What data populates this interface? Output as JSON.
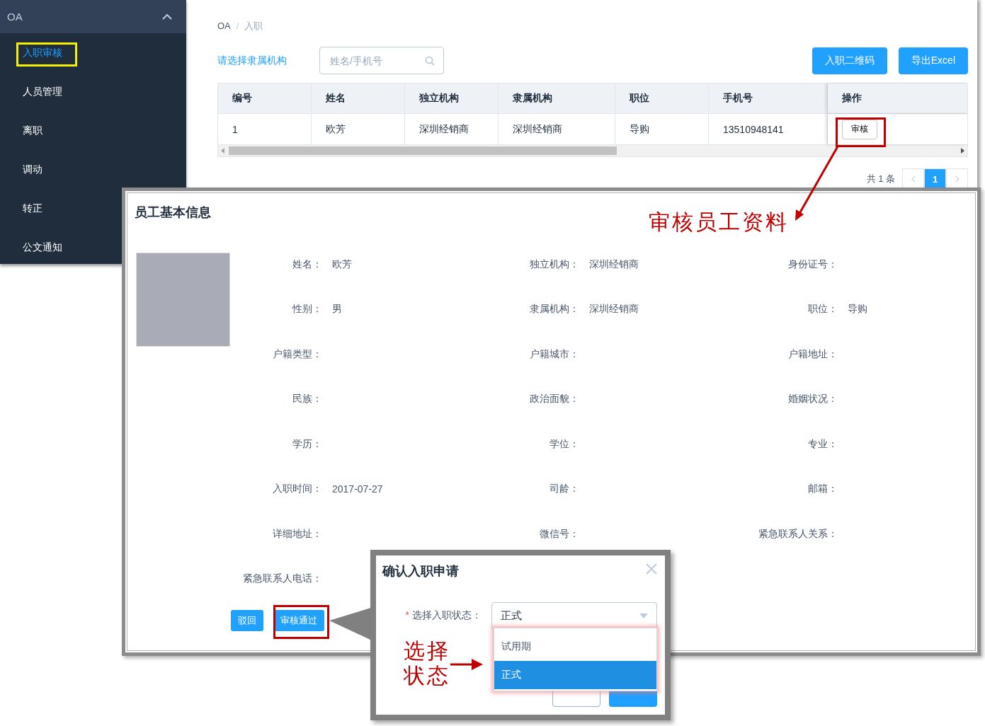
{
  "sidebar": {
    "header": "OA",
    "expanded": true,
    "items": [
      {
        "label": "入职审核",
        "selected": true
      },
      {
        "label": "人员管理",
        "selected": false
      },
      {
        "label": "离职",
        "selected": false
      },
      {
        "label": "调动",
        "selected": false
      },
      {
        "label": "转正",
        "selected": false
      },
      {
        "label": "公文通知",
        "selected": false
      }
    ]
  },
  "breadcrumb": [
    "OA",
    "入职"
  ],
  "breadcrumb_separator": "/",
  "toolbar": {
    "org_filter": "请选择隶属机构",
    "search": {
      "placeholder": "姓名/手机号"
    },
    "buttons": [
      "入职二维码",
      "导出Excel"
    ]
  },
  "table": {
    "columns": [
      "编号",
      "姓名",
      "独立机构",
      "隶属机构",
      "职位",
      "手机号",
      "操作"
    ],
    "rows": [
      {
        "cells": [
          "1",
          "欧芳",
          "深圳经销商",
          "深圳经销商",
          "导购",
          "13510948141"
        ],
        "action": "审核"
      }
    ]
  },
  "pagination": {
    "total": "共 1 条",
    "pages": [
      {
        "label": "1",
        "selected": true
      }
    ]
  },
  "detail_panel": {
    "title": "员工基本信息",
    "fields": [
      {
        "label": "姓名：",
        "value": "欧芳"
      },
      {
        "label": "独立机构：",
        "value": "深圳经销商"
      },
      {
        "label": "身份证号："
      },
      {
        "label": "性别：",
        "value": "男"
      },
      {
        "label": "隶属机构：",
        "value": "深圳经销商"
      },
      {
        "label": "职位：",
        "value": "导购"
      },
      {
        "label": "户籍类型："
      },
      {
        "label": "户籍城市："
      },
      {
        "label": "户籍地址："
      },
      {
        "label": "民族："
      },
      {
        "label": "政治面貌："
      },
      {
        "label": "婚姻状况："
      },
      {
        "label": "学历："
      },
      {
        "label": "学位："
      },
      {
        "label": "专业："
      },
      {
        "label": "入职时间：",
        "value": "2017-07-27"
      },
      {
        "label": "司龄："
      },
      {
        "label": "邮箱："
      },
      {
        "label": "详细地址："
      },
      {
        "label": "微信号："
      },
      {
        "label": "紧急联系人关系："
      },
      {
        "label": "紧急联系人电话："
      }
    ],
    "buttons": [
      "驳回",
      "审核通过"
    ]
  },
  "dialog": {
    "title": "确认入职申请",
    "field": {
      "label": "选择入职状态：",
      "required_mark": "*",
      "value": "正式"
    },
    "options": [
      {
        "label": "试用期",
        "selected": false
      },
      {
        "label": "正式",
        "selected": true
      }
    ]
  },
  "annotations": {
    "panel_note": "审核员工资料",
    "dropdown_note": [
      "选择",
      "状态"
    ]
  }
}
